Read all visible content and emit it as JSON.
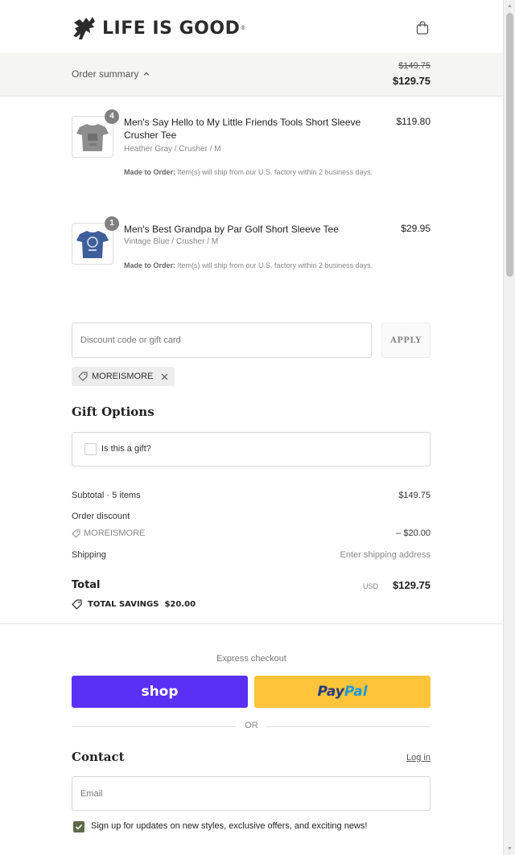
{
  "brand": {
    "name": "LIFE IS GOOD",
    "reg": "®"
  },
  "summary": {
    "toggle_label": "Order summary",
    "original_total": "$149.75",
    "total": "$129.75"
  },
  "items": [
    {
      "quantity": "4",
      "name": "Men's Say Hello to My Little Friends Tools Short Sleeve Crusher Tee",
      "variant": "Heather Gray / Crusher / M",
      "note_bold": "Made to Order:",
      "note": " Item(s) will ship from our U.S. factory within 2 business days.",
      "price": "$119.80",
      "color": "#8e8e8e"
    },
    {
      "quantity": "1",
      "name": "Men's Best Grandpa by Par Golf Short Sleeve Tee",
      "variant": "Vintage Blue / Crusher / M",
      "note_bold": "Made to Order:",
      "note": " Item(s) will ship from our U.S. factory within 2 business days.",
      "price": "$29.95",
      "color": "#3f5f9a"
    }
  ],
  "discount": {
    "placeholder": "Discount code or gift card",
    "apply_label": "APPLY",
    "applied_code": "MOREISMORE"
  },
  "gift": {
    "title": "Gift Options",
    "checkbox_label": "Is this a gift?"
  },
  "totals": {
    "subtotal_label": "Subtotal · 5 items",
    "subtotal_value": "$149.75",
    "discount_label": "Order discount",
    "discount_code": "MOREISMORE",
    "discount_value": "– $20.00",
    "shipping_label": "Shipping",
    "shipping_value": "Enter shipping address",
    "total_label": "Total",
    "currency": "USD",
    "total_value": "$129.75",
    "savings_label": "TOTAL SAVINGS",
    "savings_value": "$20.00"
  },
  "express": {
    "title": "Express checkout",
    "shop_label": "shop",
    "paypal_a": "Pay",
    "paypal_b": "Pal",
    "or_label": "OR"
  },
  "contact": {
    "title": "Contact",
    "login_label": "Log in",
    "email_placeholder": "Email",
    "newsletter_label": "Sign up for updates on new styles, exclusive offers, and exciting news!",
    "newsletter_checked": true
  },
  "colors": {
    "accent": "#5c6b47",
    "shop": "#5a31f4",
    "paypal": "#ffc439"
  }
}
